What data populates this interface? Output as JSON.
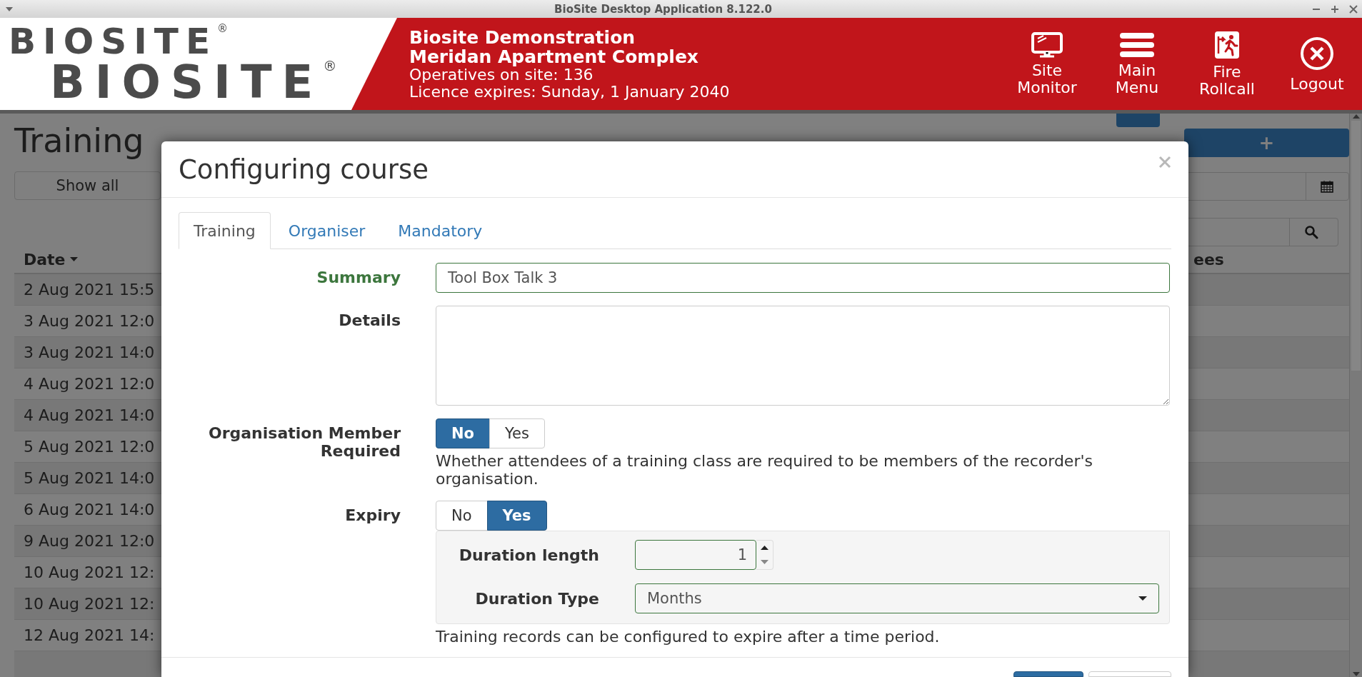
{
  "window": {
    "title": "BioSite Desktop Application 8.122.0"
  },
  "header": {
    "logo": [
      "BIOSITE$^{®}$",
      "BIOSITE$^{®}$"
    ],
    "site": "Biosite Demonstration",
    "project": "Meridan Apartment Complex",
    "operatives": "Operatives on site: 136",
    "licence": "Licence expires: Sunday, 1 January 2040",
    "nav": [
      {
        "kind": "monitor",
        "label": "Site Monitor"
      },
      {
        "kind": "menu",
        "label": "Main Menu"
      },
      {
        "kind": "fire",
        "label": "Fire Rollcall"
      },
      {
        "kind": "logout",
        "label": "Logout"
      }
    ]
  },
  "page": {
    "title": "Training",
    "show_all": "Show all",
    "add_button": "+",
    "table": {
      "columns": [
        {
          "label": "Date",
          "sorted": true
        },
        {
          "label": "ees"
        }
      ],
      "rows": [
        "2 Aug 2021 15:5",
        "3 Aug 2021 12:0",
        "3 Aug 2021 14:0",
        "4 Aug 2021 12:0",
        "4 Aug 2021 14:0",
        "5 Aug 2021 12:0",
        "5 Aug 2021 14:0",
        "6 Aug 2021 14:0",
        "9 Aug 2021 12:0",
        "10 Aug 2021 12:",
        "10 Aug 2021 12:",
        "12 Aug 2021 14:"
      ]
    }
  },
  "dialog": {
    "title": "Configuring course",
    "tabs": [
      {
        "label": "Training",
        "selected": true
      },
      {
        "label": "Organiser",
        "selected": false
      },
      {
        "label": "Mandatory",
        "selected": false
      }
    ],
    "summary": {
      "label": "Summary",
      "value": "Tool Box Talk 3",
      "valid": true
    },
    "details": {
      "label": "Details"
    },
    "org_member": {
      "label": "Organisation Member Required",
      "help": "Whether attendees of a training class are required to be members of the recorder's organisation.",
      "options": [
        {
          "label": "No",
          "selected": true
        },
        {
          "label": "Yes",
          "selected": false
        }
      ]
    },
    "expiry": {
      "label": "Expiry",
      "help": "Training records can be configured to expire after a time period.",
      "options": [
        {
          "label": "No",
          "selected": false
        },
        {
          "label": "Yes",
          "selected": true
        }
      ],
      "duration_length": {
        "label": "Duration length",
        "value": "1",
        "valid": true
      },
      "duration_type": {
        "label": "Duration Type",
        "value": "Months",
        "valid": true
      }
    }
  }
}
